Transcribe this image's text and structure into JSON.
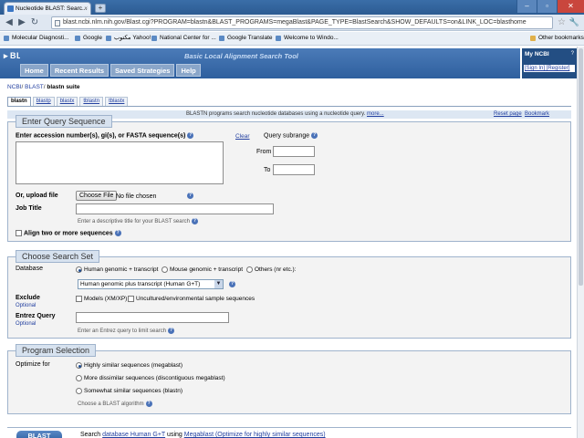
{
  "browser": {
    "tab_title": "Nucleotide BLAST: Searc...",
    "url": "blast.ncbi.nlm.nih.gov/Blast.cgi?PROGRAM=blastn&BLAST_PROGRAMS=megaBlast&PAGE_TYPE=BlastSearch&SHOW_DEFAULTS=on&LINK_LOC=blasthome",
    "bookmarks": [
      "Molecular Diagnosti...",
      "Google",
      "مكتوب Yahoo!",
      "National Center for ...",
      "Google Translate",
      "Welcome to Windo..."
    ],
    "other_bookmarks": "Other bookmarks"
  },
  "header": {
    "logo": "BLAST",
    "subtitle": "Basic Local Alignment Search Tool",
    "nav": [
      "Home",
      "Recent Results",
      "Saved Strategies",
      "Help"
    ],
    "myncbi": {
      "title": "My NCBI",
      "help": "?",
      "links": "[Sign In] [Register]"
    }
  },
  "breadcrumb": {
    "ncbi": "NCBI",
    "blast": "BLAST",
    "current": "blastn suite"
  },
  "program_tabs": [
    "blastn",
    "blastp",
    "blastx",
    "tblastn",
    "tblastx"
  ],
  "infobar": {
    "description": "BLASTN programs search nucleotide databases using a nucleotide query.",
    "more": "more...",
    "reset": "Reset page",
    "bookmark": "Bookmark"
  },
  "query": {
    "title": "Enter Query Sequence",
    "accession_label": "Enter accession number(s), gi(s), or FASTA sequence(s)",
    "clear": "Clear",
    "subrange_label": "Query subrange",
    "from_label": "From",
    "to_label": "To",
    "from_value": "",
    "to_value": "",
    "sequence_value": "",
    "upload_label": "Or, upload file",
    "choose_file": "Choose File",
    "no_file": "No file chosen",
    "job_title_label": "Job Title",
    "job_title_value": "",
    "job_title_hint": "Enter a descriptive title for your BLAST search",
    "align_two": "Align two or more sequences"
  },
  "search_set": {
    "title": "Choose Search Set",
    "database_label": "Database",
    "db_options": [
      "Human genomic + transcript",
      "Mouse genomic + transcript",
      "Others (nr etc.):"
    ],
    "db_selected": "Human genomic plus transcript (Human G+T)",
    "exclude_label": "Exclude",
    "optional": "Optional",
    "exclude_models": "Models (XM/XP)",
    "exclude_uncultured": "Uncultured/environmental sample sequences",
    "entrez_label": "Entrez Query",
    "entrez_value": "",
    "entrez_hint": "Enter an Entrez query to limit search"
  },
  "program_selection": {
    "title": "Program Selection",
    "optimize_label": "Optimize for",
    "options": [
      "Highly similar sequences (megablast)",
      "More dissimilar sequences (discontiguous megablast)",
      "Somewhat similar sequences (blastn)"
    ],
    "hint": "Choose a BLAST algorithm"
  },
  "bottom": {
    "button": "BLAST",
    "search_prefix": "Search",
    "database_link": "database Human G+T",
    "using": "using",
    "algo_link": "Megablast (Optimize for highly similar sequences)"
  }
}
